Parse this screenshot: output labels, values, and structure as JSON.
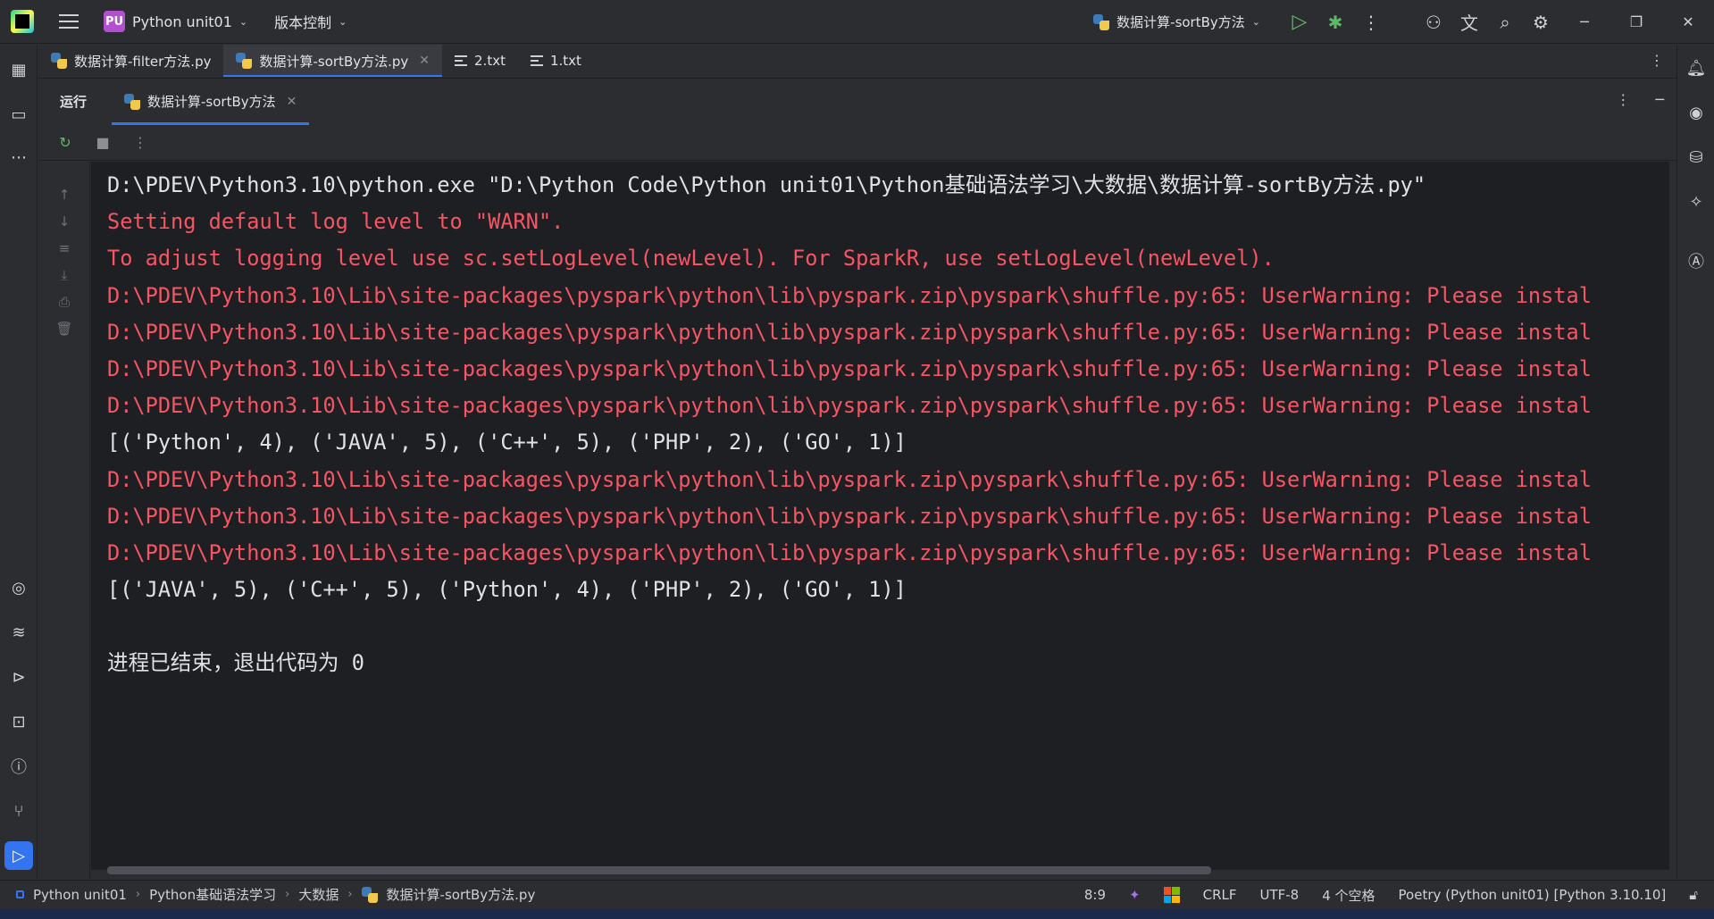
{
  "titlebar": {
    "project_badge": "PU",
    "project_name": "Python unit01",
    "vcs_label": "版本控制",
    "run_config": "数据计算-sortBy方法"
  },
  "editor_tabs": [
    {
      "label": "数据计算-filter方法.py",
      "icon": "python-file-icon"
    },
    {
      "label": "数据计算-sortBy方法.py",
      "icon": "python-file-icon",
      "active": true
    },
    {
      "label": "2.txt",
      "icon": "text-file-icon"
    },
    {
      "label": "1.txt",
      "icon": "text-file-icon"
    }
  ],
  "run_window": {
    "title": "运行",
    "tab_label": "数据计算-sortBy方法"
  },
  "console": {
    "lines": [
      {
        "type": "cmd",
        "text": "D:\\PDEV\\Python3.10\\python.exe \"D:\\Python Code\\Python unit01\\Python基础语法学习\\大数据\\数据计算-sortBy方法.py\""
      },
      {
        "type": "err",
        "text": "Setting default log level to \"WARN\"."
      },
      {
        "type": "err",
        "text": "To adjust logging level use sc.setLogLevel(newLevel). For SparkR, use setLogLevel(newLevel)."
      },
      {
        "type": "err",
        "text": "D:\\PDEV\\Python3.10\\Lib\\site-packages\\pyspark\\python\\lib\\pyspark.zip\\pyspark\\shuffle.py:65: UserWarning: Please instal"
      },
      {
        "type": "err",
        "text": "D:\\PDEV\\Python3.10\\Lib\\site-packages\\pyspark\\python\\lib\\pyspark.zip\\pyspark\\shuffle.py:65: UserWarning: Please instal"
      },
      {
        "type": "err",
        "text": "D:\\PDEV\\Python3.10\\Lib\\site-packages\\pyspark\\python\\lib\\pyspark.zip\\pyspark\\shuffle.py:65: UserWarning: Please instal"
      },
      {
        "type": "err",
        "text": "D:\\PDEV\\Python3.10\\Lib\\site-packages\\pyspark\\python\\lib\\pyspark.zip\\pyspark\\shuffle.py:65: UserWarning: Please instal"
      },
      {
        "type": "out",
        "text": "[('Python', 4), ('JAVA', 5), ('C++', 5), ('PHP', 2), ('GO', 1)]"
      },
      {
        "type": "err",
        "text": "D:\\PDEV\\Python3.10\\Lib\\site-packages\\pyspark\\python\\lib\\pyspark.zip\\pyspark\\shuffle.py:65: UserWarning: Please instal"
      },
      {
        "type": "err",
        "text": "D:\\PDEV\\Python3.10\\Lib\\site-packages\\pyspark\\python\\lib\\pyspark.zip\\pyspark\\shuffle.py:65: UserWarning: Please instal"
      },
      {
        "type": "err",
        "text": "D:\\PDEV\\Python3.10\\Lib\\site-packages\\pyspark\\python\\lib\\pyspark.zip\\pyspark\\shuffle.py:65: UserWarning: Please instal"
      },
      {
        "type": "out",
        "text": "[('JAVA', 5), ('C++', 5), ('Python', 4), ('PHP', 2), ('GO', 1)]"
      },
      {
        "type": "blank",
        "text": ""
      },
      {
        "type": "out",
        "text": "进程已结束，退出代码为 0"
      }
    ]
  },
  "statusbar": {
    "breadcrumbs": [
      "Python unit01",
      "Python基础语法学习",
      "大数据",
      "数据计算-sortBy方法.py"
    ],
    "caret": "8:9",
    "line_sep": "CRLF",
    "encoding": "UTF-8",
    "indent": "4 个空格",
    "interpreter": "Poetry (Python unit01) [Python 3.10.10]"
  },
  "colors": {
    "accent": "#3574f0",
    "error_text": "#f75464",
    "run_green": "#5fb865",
    "project_badge": "#b34fd1"
  }
}
